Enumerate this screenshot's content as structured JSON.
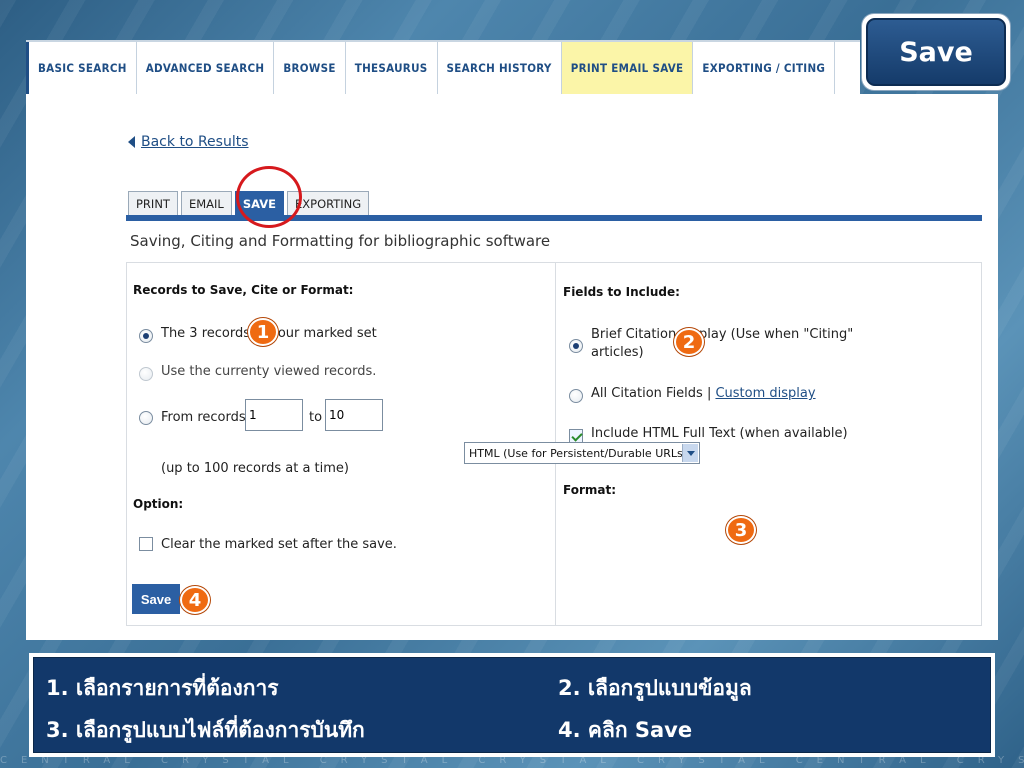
{
  "slide_title": "Save",
  "nav": {
    "items": [
      {
        "label": "BASIC SEARCH",
        "active": false
      },
      {
        "label": "ADVANCED SEARCH",
        "active": false
      },
      {
        "label": "BROWSE",
        "active": false
      },
      {
        "label": "THESAURUS",
        "active": false
      },
      {
        "label": "SEARCH HISTORY",
        "active": false
      },
      {
        "label": "PRINT EMAIL SAVE",
        "active": true
      },
      {
        "label": "EXPORTING / CITING",
        "active": false
      }
    ]
  },
  "page": {
    "back_link": "Back to Results",
    "tabs": [
      {
        "label": "PRINT",
        "active": false
      },
      {
        "label": "EMAIL",
        "active": false
      },
      {
        "label": "SAVE",
        "active": true
      },
      {
        "label": "EXPORTING",
        "active": false
      }
    ],
    "section_title": "Saving, Citing and Formatting for bibliographic software"
  },
  "records": {
    "heading": "Records to Save, Cite or Format:",
    "option_marked": "The 3 records in your marked set",
    "option_viewed": "Use the currenty viewed records.",
    "option_range_prefix": "From records",
    "range_from": "1",
    "range_to_label": "to",
    "range_to": "10",
    "range_note": "(up to 100 records at a time)",
    "option_heading": "Option:",
    "clear_marked": "Clear the marked set after the save.",
    "save_button": "Save"
  },
  "fields": {
    "heading": "Fields to Include:",
    "brief_citation": "Brief Citation display (Use when \"Citing\"",
    "brief_citation_line2": "articles)",
    "all_fields": "All Citation Fields |",
    "custom_display": "Custom display",
    "include_html": "Include HTML Full Text (when available)",
    "format_heading": "Format:",
    "format_value": "HTML (Use for Persistent/Durable URLs)"
  },
  "badges": [
    "1",
    "2",
    "3",
    "4"
  ],
  "captions": {
    "step1": "1. เลือกรายการที่ต้องการ",
    "step2": "2. เลือกรูปแบบข้อมูล",
    "step3": "3. เลือกรูปแบบไฟล์ที่ต้องการบันทึก",
    "step4": "4. คลิก Save"
  },
  "background_text": "CENTRAL CRYSTAL CRYSTAL CRYSTAL CRYSTAL CENTRAL CRYSTAL CRYSTAL CENTRA",
  "colors": {
    "nav_text": "#1f4e85",
    "active_nav_bg": "#fbf5a8",
    "tab_active": "#2b5fa3",
    "highlight_ring": "#d6191d",
    "badge": "#ef6a12",
    "caption_bg": "#12386a"
  }
}
